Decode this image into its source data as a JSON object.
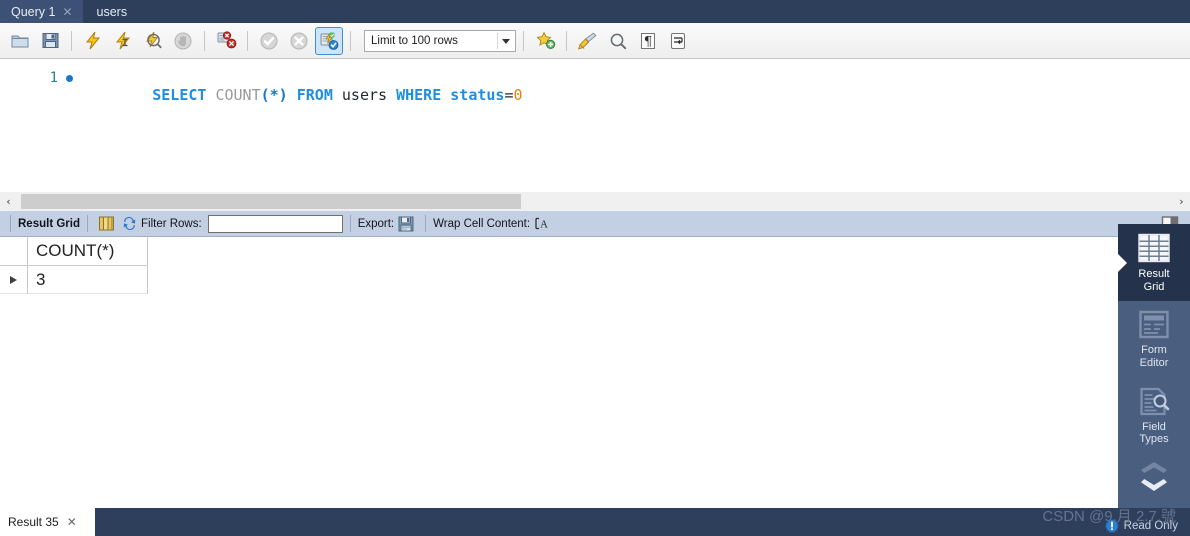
{
  "tabs": [
    {
      "label": "Query 1",
      "active": true,
      "closable": true,
      "name": "tab-query-1"
    },
    {
      "label": "users",
      "active": false,
      "closable": false,
      "name": "tab-users"
    }
  ],
  "toolbar": {
    "buttons": [
      {
        "icon": "open-folder-icon",
        "title": "Open SQL Script"
      },
      {
        "icon": "save-icon",
        "title": "Save SQL Script"
      },
      {
        "icon": "execute-icon",
        "title": "Execute Statement"
      },
      {
        "icon": "execute-current-icon",
        "title": "Execute Current Statement"
      },
      {
        "icon": "explain-icon",
        "title": "Explain Current Statement"
      },
      {
        "icon": "stop-icon",
        "title": "Stop Statement"
      },
      {
        "icon": "toggle-stop-on-error-icon",
        "title": "Toggle whether execution should stop on error"
      },
      {
        "icon": "commit-icon",
        "title": "Commit"
      },
      {
        "icon": "rollback-icon",
        "title": "Rollback"
      },
      {
        "icon": "autocommit-icon",
        "title": "Toggle Autocommit Mode",
        "selected": true
      }
    ],
    "limit_label": "Limit to 100 rows",
    "right_buttons": [
      {
        "icon": "save-snippet-icon",
        "title": "Save current statement to snippets"
      },
      {
        "icon": "beautify-icon",
        "title": "Beautify/reformat the SQL script"
      },
      {
        "icon": "find-icon",
        "title": "Find"
      },
      {
        "icon": "invisible-chars-icon",
        "title": "Toggle invisible characters"
      },
      {
        "icon": "wrap-lines-icon",
        "title": "Toggle wrapping of long lines"
      }
    ]
  },
  "editor": {
    "line_number": "1",
    "tokens": [
      {
        "text": "SELECT",
        "type": "kw"
      },
      {
        "text": " ",
        "type": "sp"
      },
      {
        "text": "COUNT",
        "type": "fn"
      },
      {
        "text": "(*)",
        "type": "punc"
      },
      {
        "text": " ",
        "type": "sp"
      },
      {
        "text": "FROM",
        "type": "kw"
      },
      {
        "text": " ",
        "type": "sp"
      },
      {
        "text": "users",
        "type": "id"
      },
      {
        "text": " ",
        "type": "sp"
      },
      {
        "text": "WHERE",
        "type": "kw"
      },
      {
        "text": " ",
        "type": "sp"
      },
      {
        "text": "status",
        "type": "kw"
      },
      {
        "text": "=",
        "type": "id"
      },
      {
        "text": "0",
        "type": "num"
      }
    ],
    "full_text": "SELECT COUNT(*) FROM users WHERE status=0"
  },
  "scrollbar": {
    "left_arrow": "‹",
    "right_arrow": "›"
  },
  "grid_toolbar": {
    "result_grid_label": "Result Grid",
    "filter_label": "Filter Rows:",
    "filter_value": "",
    "export_label": "Export:",
    "wrap_label": "Wrap Cell Content:",
    "wrap_glyph": "⫪ A"
  },
  "grid": {
    "columns": [
      "COUNT(*)"
    ],
    "rows": [
      [
        "3"
      ]
    ]
  },
  "sidebar": {
    "items": [
      {
        "label": "Result\nGrid",
        "icon": "result-grid-icon",
        "active": true,
        "name": "sidebar-item-result-grid"
      },
      {
        "label": "Form\nEditor",
        "icon": "form-editor-icon",
        "active": false,
        "name": "sidebar-item-form-editor"
      },
      {
        "label": "Field\nTypes",
        "icon": "field-types-icon",
        "active": false,
        "name": "sidebar-item-field-types"
      }
    ]
  },
  "bottom": {
    "result_tab_label": "Result 35",
    "close_glyph": "✕",
    "read_only": "Read Only"
  },
  "watermark": {
    "text": "CSDN @9.月 2.7.號"
  },
  "colors": {
    "tabbar_bg": "#2e3f5b",
    "tab_active_bg": "#3d5075",
    "grid_toolbar_bg": "#c3cfe2",
    "sidebar_bg": "#4a5e80",
    "sidebar_active_bg": "#24324b",
    "keyword": "#1f8ee0",
    "number": "#e8820a",
    "function": "#9a9a9a"
  }
}
